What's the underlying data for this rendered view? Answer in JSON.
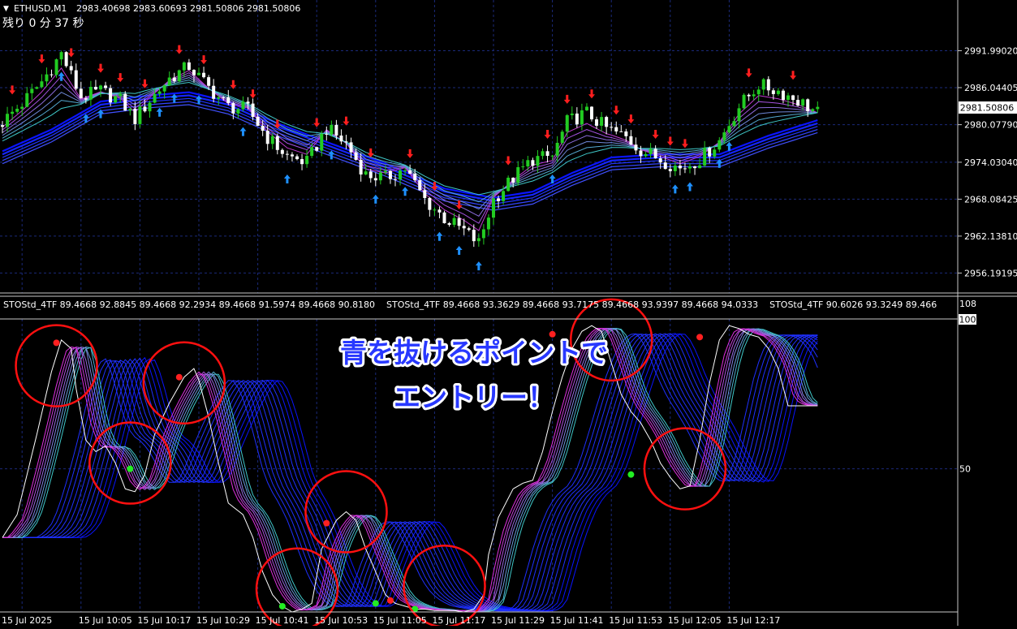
{
  "header": {
    "symbol": "ETHUSD,M1",
    "ohlc": "2983.40698 2983.60693 2981.50806 2981.50806",
    "countdown": "残り 0 分 37 秒"
  },
  "indicator_label": "STOStd_4TF 89.4668 92.8845 89.4668 92.2934 89.4668 91.5974 89.4668 90.8180    STOStd_4TF 89.4668 93.3629 89.4668 93.7175 89.4668 93.9397 89.4668 94.0333    STOStd_4TF 90.6026 93.3249 89.466",
  "annotation": {
    "line1": "青を抜けるポイントで",
    "line2": "エントリー！"
  },
  "colors": {
    "background": "#000000",
    "grid": "#1b2a7a",
    "bull_candle": "#22cc22",
    "bear_candle": "#ffffff",
    "ma_blue": "#1e2bff",
    "ma_magenta": "#d838e0",
    "ma_cyan": "#3fd3c8",
    "signal_down": "#ff1e1e",
    "signal_up": "#1e90ff",
    "circle": "#ff1010",
    "dot_red": "#ff2020",
    "dot_green": "#22ee22",
    "annotation_fill": "#2838ff"
  },
  "chart_data": [
    {
      "type": "candlestick",
      "title": "ETHUSD,M1",
      "y_ticks": [
        "2991.99020",
        "2986.04405",
        "2980.07790",
        "2974.03040",
        "2968.08425",
        "2962.13810",
        "2956.19195"
      ],
      "ylim": [
        2953.5,
        2999.5
      ],
      "current_price": "2981.50806",
      "x_ticks": [
        "15 Jul 2025",
        "15 Jul 10:05",
        "15 Jul 10:17",
        "15 Jul 10:29",
        "15 Jul 10:41",
        "15 Jul 10:53",
        "15 Jul 11:05",
        "15 Jul 11:17",
        "15 Jul 11:29",
        "15 Jul 11:41",
        "15 Jul 11:53",
        "15 Jul 12:05",
        "15 Jul 12:17"
      ],
      "bars_per_tick": 12,
      "close_path": [
        [
          0,
          2980.5
        ],
        [
          4,
          2983.5
        ],
        [
          8,
          2987.0
        ],
        [
          12,
          2991.5
        ],
        [
          16,
          2984.5
        ],
        [
          20,
          2985.5
        ],
        [
          24,
          2984.0
        ],
        [
          27,
          2981.0
        ],
        [
          30,
          2984.0
        ],
        [
          34,
          2987.5
        ],
        [
          38,
          2989.5
        ],
        [
          42,
          2986.0
        ],
        [
          46,
          2983.0
        ],
        [
          50,
          2982.5
        ],
        [
          54,
          2978.0
        ],
        [
          58,
          2975.0
        ],
        [
          62,
          2974.0
        ],
        [
          66,
          2979.5
        ],
        [
          70,
          2977.0
        ],
        [
          74,
          2972.0
        ],
        [
          78,
          2971.5
        ],
        [
          82,
          2973.0
        ],
        [
          86,
          2968.0
        ],
        [
          90,
          2965.0
        ],
        [
          94,
          2963.0
        ],
        [
          97,
          2961.0
        ],
        [
          100,
          2968.0
        ],
        [
          104,
          2971.5
        ],
        [
          108,
          2974.5
        ],
        [
          112,
          2975.0
        ],
        [
          115,
          2980.5
        ],
        [
          119,
          2982.0
        ],
        [
          123,
          2979.5
        ],
        [
          127,
          2978.0
        ],
        [
          130,
          2976.0
        ],
        [
          134,
          2974.5
        ],
        [
          138,
          2973.0
        ],
        [
          142,
          2974.5
        ],
        [
          146,
          2977.5
        ],
        [
          150,
          2983.0
        ],
        [
          154,
          2986.5
        ],
        [
          158,
          2985.5
        ],
        [
          162,
          2984.0
        ],
        [
          166,
          2982.0
        ]
      ],
      "ma_band": [
        [
          0,
          2977.0
        ],
        [
          10,
          2980.5
        ],
        [
          20,
          2985.0
        ],
        [
          30,
          2986.0
        ],
        [
          38,
          2986.5
        ],
        [
          46,
          2985.0
        ],
        [
          56,
          2981.5
        ],
        [
          66,
          2978.5
        ],
        [
          78,
          2975.0
        ],
        [
          90,
          2971.0
        ],
        [
          100,
          2969.5
        ],
        [
          108,
          2970.5
        ],
        [
          116,
          2973.5
        ],
        [
          124,
          2976.0
        ],
        [
          134,
          2976.5
        ],
        [
          146,
          2976.5
        ],
        [
          156,
          2979.5
        ],
        [
          166,
          2982.0
        ]
      ],
      "down_arrows": [
        2,
        8,
        14,
        20,
        24,
        29,
        36,
        41,
        47,
        51,
        56,
        64,
        70,
        75,
        83,
        88,
        93,
        103,
        111,
        115,
        120,
        125,
        128,
        133,
        136,
        139,
        152,
        161
      ],
      "up_arrows": [
        12,
        17,
        20,
        32,
        35,
        40,
        49,
        58,
        67,
        76,
        82,
        89,
        93,
        97,
        112,
        137,
        140,
        146,
        148
      ]
    },
    {
      "type": "line",
      "title": "STOStd_4TF",
      "ylim": [
        0,
        108
      ],
      "y_ticks": [
        "108",
        "100",
        "50"
      ],
      "series": [
        {
          "values": [
            [
              0,
              26
            ],
            [
              3,
              34
            ],
            [
              7,
              62
            ],
            [
              10,
              84
            ],
            [
              12,
              95
            ],
            [
              14,
              92
            ],
            [
              15,
              78
            ],
            [
              17,
              60
            ],
            [
              19,
              56
            ],
            [
              21,
              58
            ],
            [
              23,
              52
            ],
            [
              25,
              43
            ],
            [
              27,
              42
            ],
            [
              29,
              48
            ],
            [
              31,
              62
            ],
            [
              34,
              73
            ],
            [
              37,
              82
            ],
            [
              39,
              85
            ],
            [
              40,
              81
            ],
            [
              42,
              68
            ],
            [
              44,
              52
            ],
            [
              46,
              38
            ],
            [
              49,
              34
            ],
            [
              51,
              26
            ],
            [
              53,
              14
            ],
            [
              55,
              6
            ],
            [
              57,
              2
            ],
            [
              59,
              0
            ],
            [
              61,
              1
            ],
            [
              63,
              3
            ],
            [
              65,
              22
            ],
            [
              68,
              32
            ],
            [
              70,
              35
            ],
            [
              72,
              32
            ],
            [
              74,
              22
            ],
            [
              76,
              14
            ],
            [
              78,
              6
            ],
            [
              80,
              3
            ],
            [
              82,
              2
            ],
            [
              84,
              1
            ],
            [
              86,
              1
            ],
            [
              88,
              0.5
            ],
            [
              90,
              0.5
            ],
            [
              92,
              0.5
            ],
            [
              94,
              0
            ],
            [
              96,
              1
            ],
            [
              98,
              6
            ],
            [
              99,
              20
            ],
            [
              101,
              33
            ],
            [
              104,
              43
            ],
            [
              106,
              45
            ],
            [
              108,
              46
            ],
            [
              110,
              56
            ],
            [
              112,
              70
            ],
            [
              114,
              82
            ],
            [
              116,
              92
            ],
            [
              118,
              98
            ],
            [
              120,
              100
            ],
            [
              122,
              98
            ],
            [
              124,
              87
            ],
            [
              126,
              76
            ],
            [
              128,
              70
            ],
            [
              130,
              66
            ],
            [
              132,
              60
            ],
            [
              134,
              52
            ],
            [
              136,
              47
            ],
            [
              138,
              43
            ],
            [
              140,
              44
            ],
            [
              142,
              60
            ],
            [
              144,
              80
            ],
            [
              146,
              95
            ],
            [
              148,
              100
            ],
            [
              150,
              99
            ],
            [
              152,
              97
            ],
            [
              154,
              96
            ],
            [
              156,
              92
            ],
            [
              158,
              85
            ],
            [
              160,
              72
            ]
          ]
        }
      ],
      "x_ticks": [
        "15 Jul 2025",
        "15 Jul 10:05",
        "15 Jul 10:17",
        "15 Jul 10:29",
        "15 Jul 10:41",
        "15 Jul 10:53",
        "15 Jul 11:05",
        "15 Jul 11:17",
        "15 Jul 11:29",
        "15 Jul 11:41",
        "15 Jul 11:53",
        "15 Jul 12:05",
        "15 Jul 12:17"
      ],
      "highlight_circles": [
        {
          "bar": 11,
          "value": 86
        },
        {
          "bar": 26,
          "value": 52
        },
        {
          "bar": 37,
          "value": 80
        },
        {
          "bar": 60,
          "value": 8
        },
        {
          "bar": 70,
          "value": 35
        },
        {
          "bar": 90,
          "value": 9
        },
        {
          "bar": 124,
          "value": 95
        },
        {
          "bar": 139,
          "value": 50
        }
      ],
      "signal_dots": [
        {
          "bar": 11,
          "value": 94,
          "kind": "red"
        },
        {
          "bar": 26,
          "value": 50,
          "kind": "green"
        },
        {
          "bar": 36,
          "value": 82,
          "kind": "red"
        },
        {
          "bar": 57,
          "value": 2,
          "kind": "green"
        },
        {
          "bar": 66,
          "value": 31,
          "kind": "red"
        },
        {
          "bar": 76,
          "value": 3,
          "kind": "green"
        },
        {
          "bar": 79,
          "value": 4,
          "kind": "red"
        },
        {
          "bar": 84,
          "value": 1,
          "kind": "green"
        },
        {
          "bar": 112,
          "value": 97,
          "kind": "red"
        },
        {
          "bar": 128,
          "value": 48,
          "kind": "green"
        },
        {
          "bar": 142,
          "value": 96,
          "kind": "red"
        }
      ]
    }
  ]
}
